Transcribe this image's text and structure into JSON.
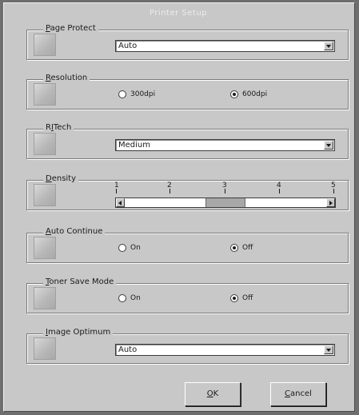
{
  "window": {
    "title": "Printer Setup"
  },
  "page_protect": {
    "label_u": "P",
    "label_rest": "age Protect",
    "value": "Auto"
  },
  "resolution": {
    "label_u": "R",
    "label_rest": "esolution",
    "options": [
      {
        "label": "300dpi",
        "selected": false
      },
      {
        "label": "600dpi",
        "selected": true
      }
    ]
  },
  "ritech": {
    "label_pre": "R",
    "label_u": "I",
    "label_rest": "Tech",
    "value": "Medium"
  },
  "density": {
    "label_u": "D",
    "label_rest": "ensity",
    "ticks": [
      "1",
      "2",
      "3",
      "4",
      "5"
    ],
    "value": 3
  },
  "auto_continue": {
    "label_u": "A",
    "label_rest": "uto Continue",
    "options": [
      {
        "label": "On",
        "selected": false
      },
      {
        "label": "Off",
        "selected": true
      }
    ]
  },
  "toner_save": {
    "label_u": "T",
    "label_rest": "oner Save Mode",
    "options": [
      {
        "label": "On",
        "selected": false
      },
      {
        "label": "Off",
        "selected": true
      }
    ]
  },
  "image_optimum": {
    "label_u": "I",
    "label_rest": "mage Optimum",
    "value": "Auto"
  },
  "buttons": {
    "ok": {
      "u": "O",
      "rest": "K"
    },
    "cancel": {
      "u": "C",
      "rest": "ancel"
    }
  }
}
